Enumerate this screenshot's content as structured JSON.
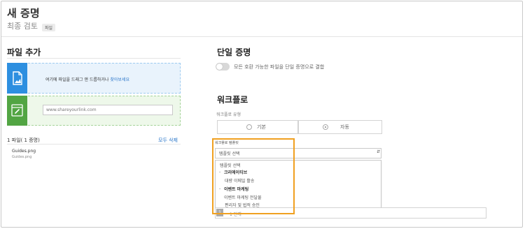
{
  "header": {
    "title": "새 증명",
    "subtitle": "최종 검토",
    "badge": "파일"
  },
  "left_panel": {
    "title": "파일 추가",
    "drop_text": "여기에 파일을 드래그 앤 드롭하거나",
    "drop_link": "찾아보세요",
    "link_placeholder": "www.shareyourlink.com",
    "files_count": "1 파일( 1 증명)",
    "delete_all": "모두 삭제",
    "files": [
      {
        "name": "Guides.png",
        "sub": "Guides.png"
      }
    ]
  },
  "single_proof": {
    "title": "단일 증명",
    "toggle_label": "모든 호환 가능한 파일을 단일 증명으로 결합",
    "toggle_on": false
  },
  "workflow": {
    "title": "워크플로",
    "type_label": "워크플로 유형",
    "type_options": [
      "기본",
      "자동"
    ],
    "selected_type": "자동",
    "template_label": "워크플로 템플릿",
    "template_selected": "템플릿 선택",
    "template_options": [
      {
        "label": "템플릿 선택",
        "kind": "item"
      },
      {
        "label": "크리에이티브",
        "kind": "group"
      },
      {
        "label": "대량 이메일 활송",
        "kind": "item"
      },
      {
        "label": "이벤트 마케팅",
        "kind": "group"
      },
      {
        "label": "이벤트 마케팅 전달물",
        "kind": "item"
      },
      {
        "label": "편리자 및 법적 승인",
        "kind": "item"
      }
    ],
    "step_number": "1",
    "step_label": "1 단계"
  },
  "colors": {
    "accent_blue": "#2d8fe0",
    "accent_green": "#52a543",
    "highlight_orange": "#f0a020",
    "link_blue": "#2a76c9"
  }
}
